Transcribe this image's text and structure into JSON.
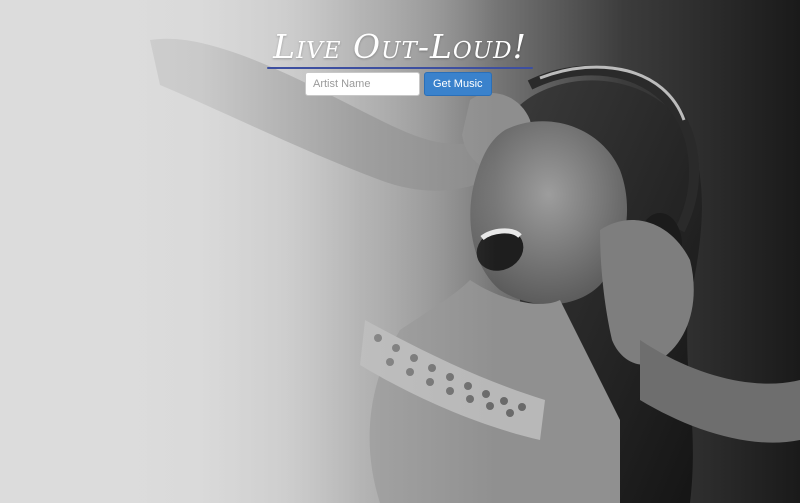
{
  "header": {
    "logo_text": "Live Out-Loud!"
  },
  "search": {
    "placeholder": "Artist Name",
    "value": "",
    "button_label": "Get Music"
  },
  "hero": {
    "description_icon": "headphones-woman-photo"
  },
  "colors": {
    "accent": "#3a82cc",
    "logo_underline": "#3d4fa0"
  }
}
